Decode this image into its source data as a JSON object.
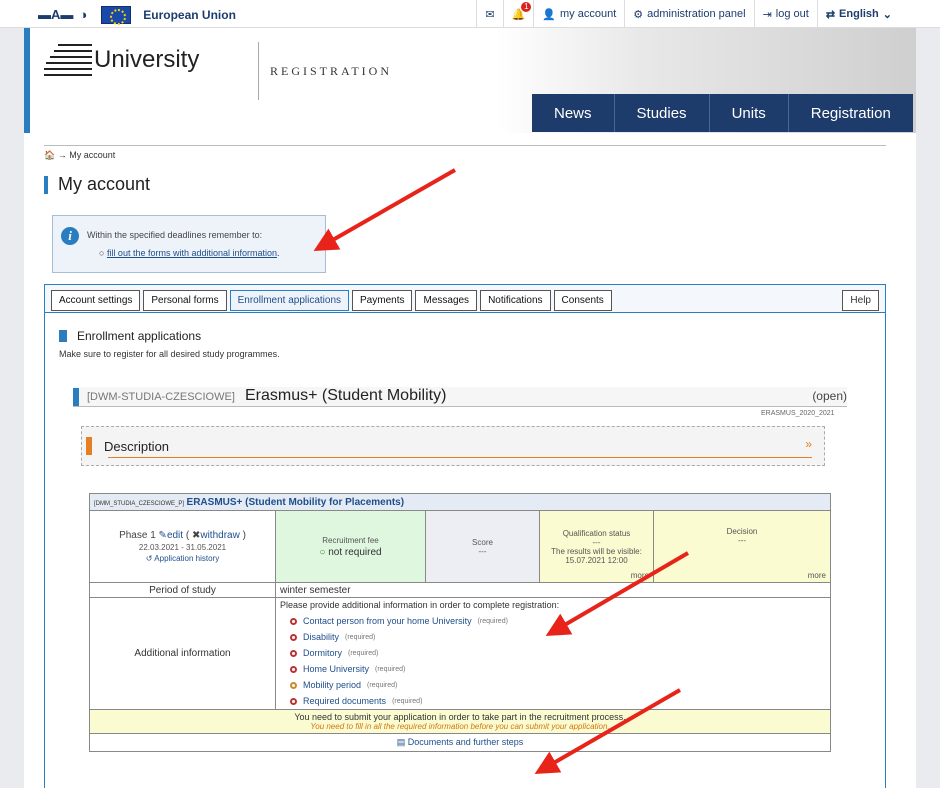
{
  "topbar": {
    "accessibility": [
      "▬A▬",
      "◑"
    ],
    "eu_label": "European Union",
    "notification_count": "1",
    "my_account": "my account",
    "admin_panel": "administration panel",
    "logout": "log out",
    "language": "English"
  },
  "header": {
    "logo_text": "University",
    "subtitle": "REGISTRATION",
    "nav": [
      "News",
      "Studies",
      "Units",
      "Registration"
    ]
  },
  "breadcrumb": {
    "home_icon": "home-icon",
    "current": "My account"
  },
  "page_title": "My account",
  "info": {
    "text": "Within the specified deadlines remember to:",
    "link": "fill out the forms with additional information",
    "link_suffix": "."
  },
  "tabs": [
    "Account settings",
    "Personal forms",
    "Enrollment applications",
    "Payments",
    "Messages",
    "Notifications",
    "Consents"
  ],
  "active_tab": "Enrollment applications",
  "help_tab": "Help",
  "section": {
    "title": "Enrollment applications",
    "subtitle": "Make sure to register for all desired study programmes."
  },
  "application": {
    "code": "[DWM-STUDIA-CZESCIOWE]",
    "name": "Erasmus+ (Student Mobility)",
    "status": "(open)",
    "id": "ERASMUS_2020_2021",
    "description_title": "Description"
  },
  "detail": {
    "code": "[DMM_STUDIA_CZESCIOWE_P]",
    "name": "ERASMUS+ (Student Mobility for Placements)",
    "phase": "Phase 1",
    "edit": "edit",
    "withdraw": "withdraw",
    "dates": "22.03.2021 - 31.05.2021",
    "history": "Application history",
    "fee_label": "Recruitment fee",
    "fee_value": "not required",
    "score_label": "Score",
    "score_value": "---",
    "qual_label": "Qualification status",
    "qual_value": "---",
    "qual_note": "The results will be visible:",
    "qual_date": "15.07.2021 12:00",
    "decision_label": "Decision",
    "decision_value": "---",
    "more": "more",
    "period_label": "Period of study",
    "period_value": "winter semester",
    "additional_label": "Additional information",
    "additional_intro": "Please provide additional information in order to complete registration:",
    "additional_items": [
      {
        "name": "Contact person from your home University",
        "req": "(required)"
      },
      {
        "name": "Disability",
        "req": "(required)"
      },
      {
        "name": "Dormitory",
        "req": "(required)"
      },
      {
        "name": "Home University",
        "req": "(required)"
      },
      {
        "name": "Mobility period",
        "req": "(required)"
      },
      {
        "name": "Required documents",
        "req": "(required)"
      }
    ],
    "submit_note": "You need to submit your application in order to take part in the recruitment process.",
    "submit_warning": "You need to fill in all the required information before you can submit your application.",
    "docs_link": "Documents and further steps"
  },
  "colors": {
    "accent": "#2a7ec0",
    "nav": "#1e3c6b",
    "arrow": "#e8231a",
    "orange": "#e67e22"
  }
}
